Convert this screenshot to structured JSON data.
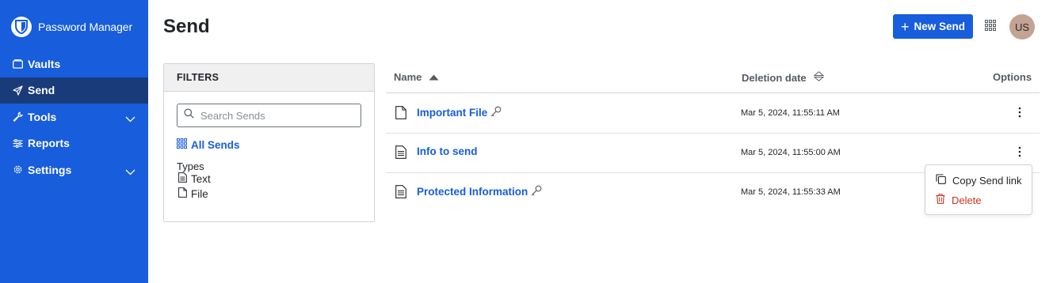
{
  "app": {
    "name": "Password Manager"
  },
  "sidebar": {
    "items": [
      {
        "label": "Vaults",
        "icon": "vault-icon",
        "active": false,
        "expandable": false
      },
      {
        "label": "Send",
        "icon": "send-icon",
        "active": true,
        "expandable": false
      },
      {
        "label": "Tools",
        "icon": "wrench-icon",
        "active": false,
        "expandable": true
      },
      {
        "label": "Reports",
        "icon": "sliders-icon",
        "active": false,
        "expandable": false
      },
      {
        "label": "Settings",
        "icon": "gear-icon",
        "active": false,
        "expandable": true
      }
    ]
  },
  "header": {
    "title": "Send",
    "new_send_label": "New Send",
    "avatar_initials": "US"
  },
  "filters": {
    "title": "FILTERS",
    "search_placeholder": "Search Sends",
    "all_sends_label": "All Sends",
    "types_label": "Types",
    "types": [
      {
        "label": "Text",
        "icon": "text-file-icon"
      },
      {
        "label": "File",
        "icon": "file-icon"
      }
    ]
  },
  "table": {
    "columns": {
      "name": "Name",
      "deletion_date": "Deletion date",
      "options": "Options"
    },
    "rows": [
      {
        "name": "Important File",
        "type_icon": "file-icon",
        "protected": true,
        "deletion_date": "Mar 5, 2024, 11:55:11 AM"
      },
      {
        "name": "Info to send",
        "type_icon": "text-file-icon",
        "protected": false,
        "deletion_date": "Mar 5, 2024, 11:55:00 AM"
      },
      {
        "name": "Protected Information",
        "type_icon": "text-file-icon",
        "protected": true,
        "deletion_date": "Mar 5, 2024, 11:55:33 AM"
      }
    ]
  },
  "options_menu": {
    "copy_label": "Copy Send link",
    "delete_label": "Delete"
  },
  "colors": {
    "brand": "#175ddc",
    "sidebar_active": "#1a3b7a",
    "danger": "#c83522"
  }
}
